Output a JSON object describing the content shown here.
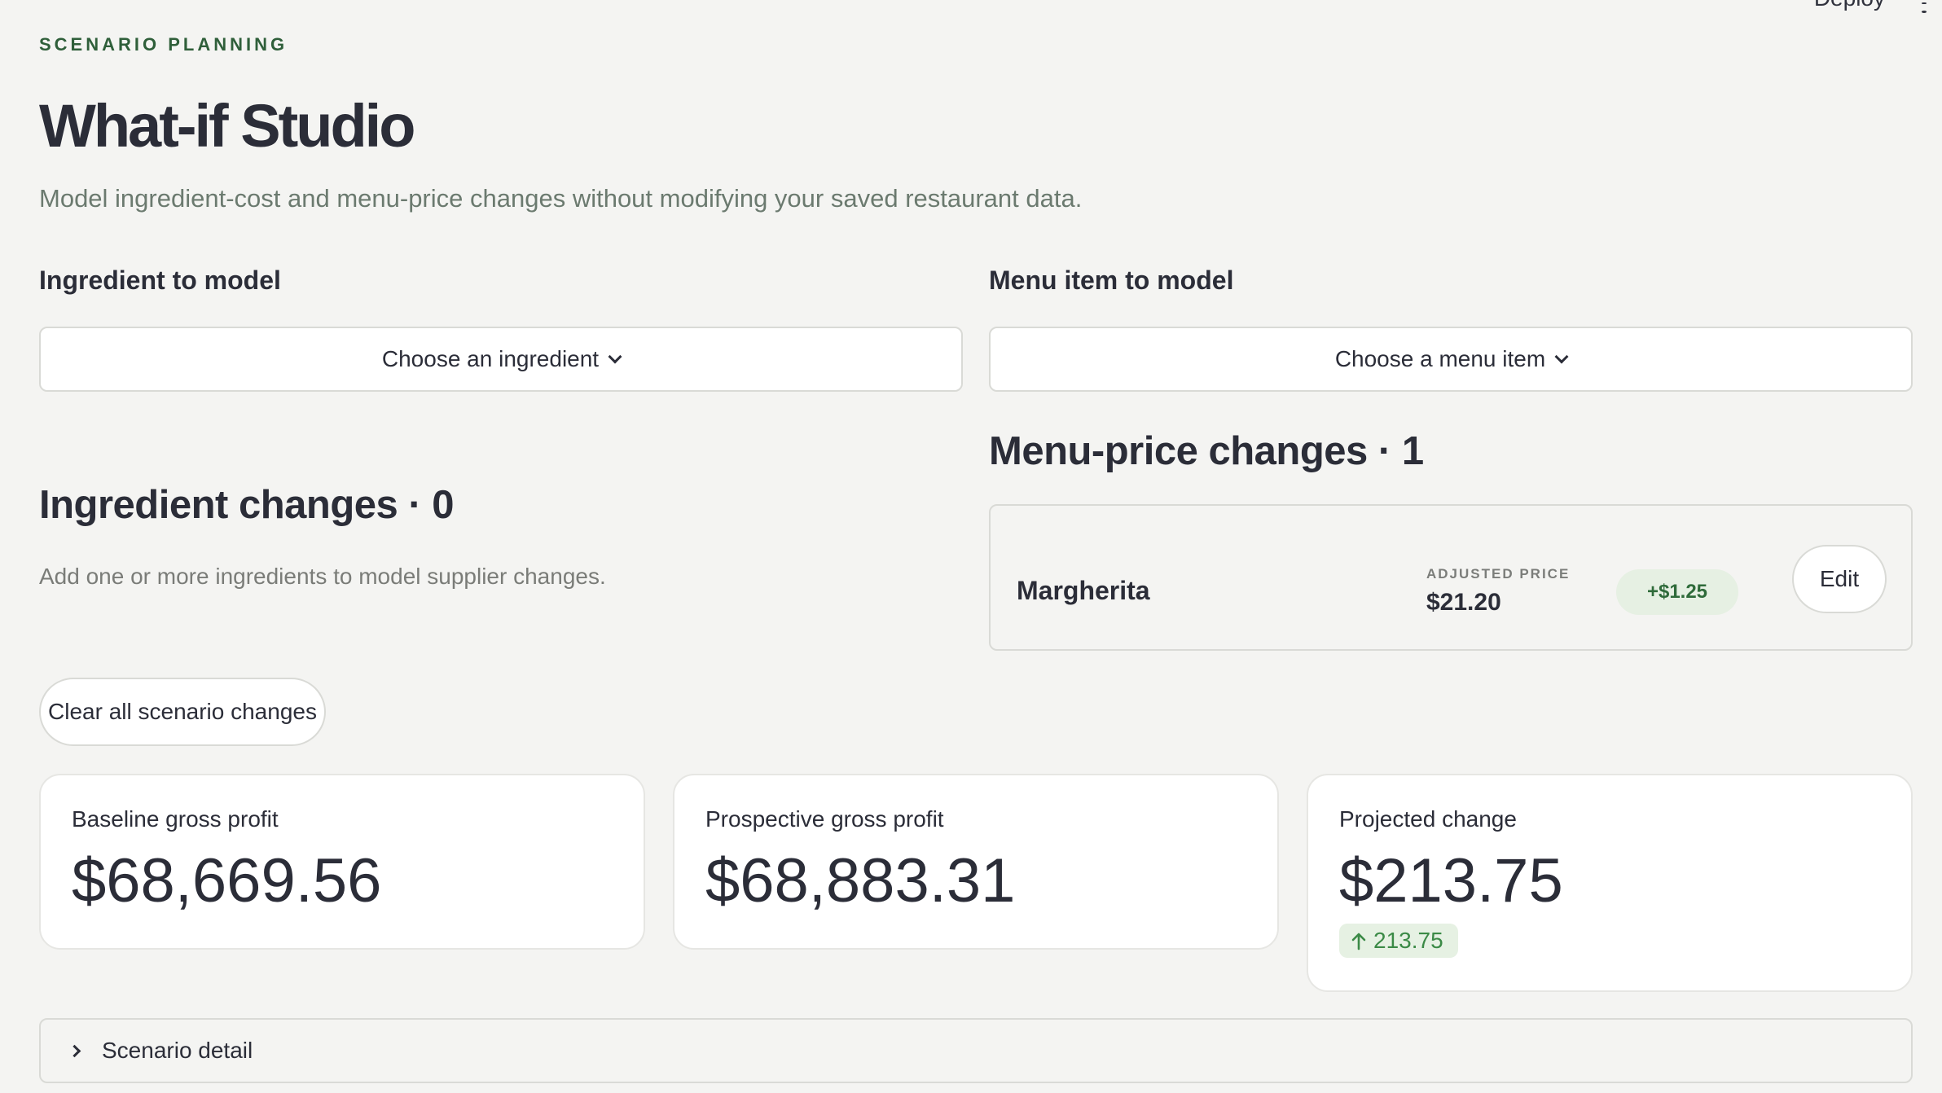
{
  "header": {
    "deploy_label": "Deploy",
    "menu_icon": "kebab-menu-icon"
  },
  "hero": {
    "eyebrow": "SCENARIO PLANNING",
    "title": "What-if Studio",
    "subtitle": "Model ingredient-cost and menu-price changes without modifying your saved restaurant data."
  },
  "ingredient_picker": {
    "label": "Ingredient to model",
    "placeholder": "Choose an ingredient",
    "icon": "chevron-down-icon"
  },
  "menu_picker": {
    "label": "Menu item to model",
    "placeholder": "Choose a menu item",
    "icon": "chevron-down-icon"
  },
  "ingredient_changes": {
    "heading": "Ingredient changes · 0",
    "helper": "Add one or more ingredients to model supplier changes."
  },
  "menu_price_changes": {
    "heading": "Menu-price changes · 1",
    "items": [
      {
        "name": "Margherita",
        "adjusted_label": "ADJUSTED PRICE",
        "adjusted_value": "$21.20",
        "delta": "+$1.25",
        "edit_label": "Edit"
      }
    ]
  },
  "actions": {
    "clear_label": "Clear all scenario changes"
  },
  "metrics": [
    {
      "label": "Baseline gross profit",
      "value": "$68,669.56"
    },
    {
      "label": "Prospective gross profit",
      "value": "$68,883.31"
    },
    {
      "label": "Projected change",
      "value": "$213.75",
      "delta": "213.75",
      "delta_icon": "arrow-up-icon"
    }
  ],
  "scenario_detail": {
    "label": "Scenario detail",
    "icon": "chevron-right-icon"
  },
  "colors": {
    "background": "#f4f4f2",
    "accent_green": "#2f5f3a",
    "positive_bg": "#e6f1e3",
    "positive_text": "#3b8a46"
  }
}
